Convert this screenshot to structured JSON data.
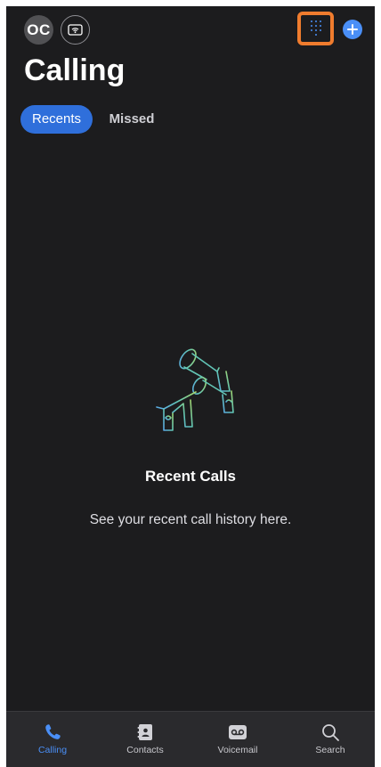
{
  "header": {
    "avatar_initials": "OC",
    "title": "Calling"
  },
  "tabs": [
    {
      "label": "Recents",
      "active": true
    },
    {
      "label": "Missed",
      "active": false
    }
  ],
  "empty_state": {
    "title": "Recent Calls",
    "description": "See your recent call history here."
  },
  "tabbar": {
    "items": [
      {
        "label": "Calling",
        "icon": "phone-icon",
        "active": true
      },
      {
        "label": "Contacts",
        "icon": "contacts-icon",
        "active": false
      },
      {
        "label": "Voicemail",
        "icon": "voicemail-icon",
        "active": false
      },
      {
        "label": "Search",
        "icon": "search-icon",
        "active": false
      }
    ]
  },
  "colors": {
    "background": "#1c1c1e",
    "accent": "#2f6fdb",
    "highlight_outline": "#f07c2e",
    "tabbar_background": "#2a2a2d"
  }
}
